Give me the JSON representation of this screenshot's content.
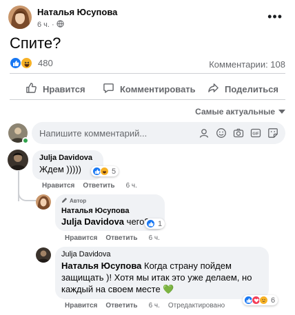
{
  "post": {
    "author": "Наталья Юсупова",
    "time": "6 ч.",
    "separator": "·",
    "text": "Спите?",
    "reactions_count": "480",
    "comments_count": "Комментарии: 108"
  },
  "actions": {
    "like": "Нравится",
    "comment": "Комментировать",
    "share": "Поделиться"
  },
  "sort": {
    "label": "Самые актуальные"
  },
  "comment_input": {
    "placeholder": "Напишите комментарий..."
  },
  "comments": [
    {
      "author": "Julja Davidova",
      "text": "Ждем )))))",
      "reactions": "5",
      "actions": {
        "like": "Нравится",
        "reply": "Ответить",
        "time": "6 ч."
      }
    },
    {
      "badge": "Автор",
      "author": "Наталья Юсупова",
      "mention": "Julja Davidova",
      "text": "чего?",
      "reactions": "1",
      "actions": {
        "like": "Нравится",
        "reply": "Ответить",
        "time": "6 ч."
      }
    },
    {
      "author": "Julja Davidova",
      "mention": "Наталья Юсупова",
      "text": "Когда страну пойдем защищать )! Хотя мы итак это уже делаем, но каждый на своем месте",
      "emoji": "💚",
      "reactions": "6",
      "actions": {
        "like": "Нравится",
        "reply": "Ответить",
        "time": "6 ч.",
        "edited": "Отредактировано"
      }
    }
  ],
  "colors": {
    "accent": "#1877f2",
    "haha": "#f7b125",
    "love": "#f33e58",
    "bubble": "#f0f2f5",
    "muted": "#65676b"
  }
}
